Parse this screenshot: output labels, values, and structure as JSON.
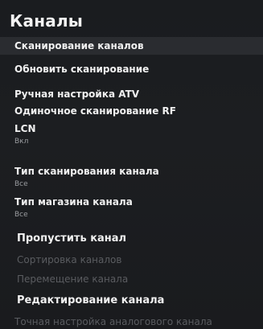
{
  "header": {
    "title": "Каналы"
  },
  "menu": {
    "items": [
      {
        "label": "Сканирование каналов"
      },
      {
        "label": "Обновить сканирование"
      },
      {
        "label": "Ручная настройка ATV"
      },
      {
        "label": "Одиночное сканирование RF"
      },
      {
        "label": "LCN",
        "value": "Вкл"
      },
      {
        "label": "Тип сканирования канала",
        "value": "Все"
      },
      {
        "label": "Тип магазина канала",
        "value": "Все"
      },
      {
        "label": "Пропустить канал"
      },
      {
        "label": "Сортировка каналов"
      },
      {
        "label": "Перемещение канала"
      },
      {
        "label": "Редактирование канала"
      },
      {
        "label": "Точная настройка аналогового канала"
      }
    ]
  }
}
